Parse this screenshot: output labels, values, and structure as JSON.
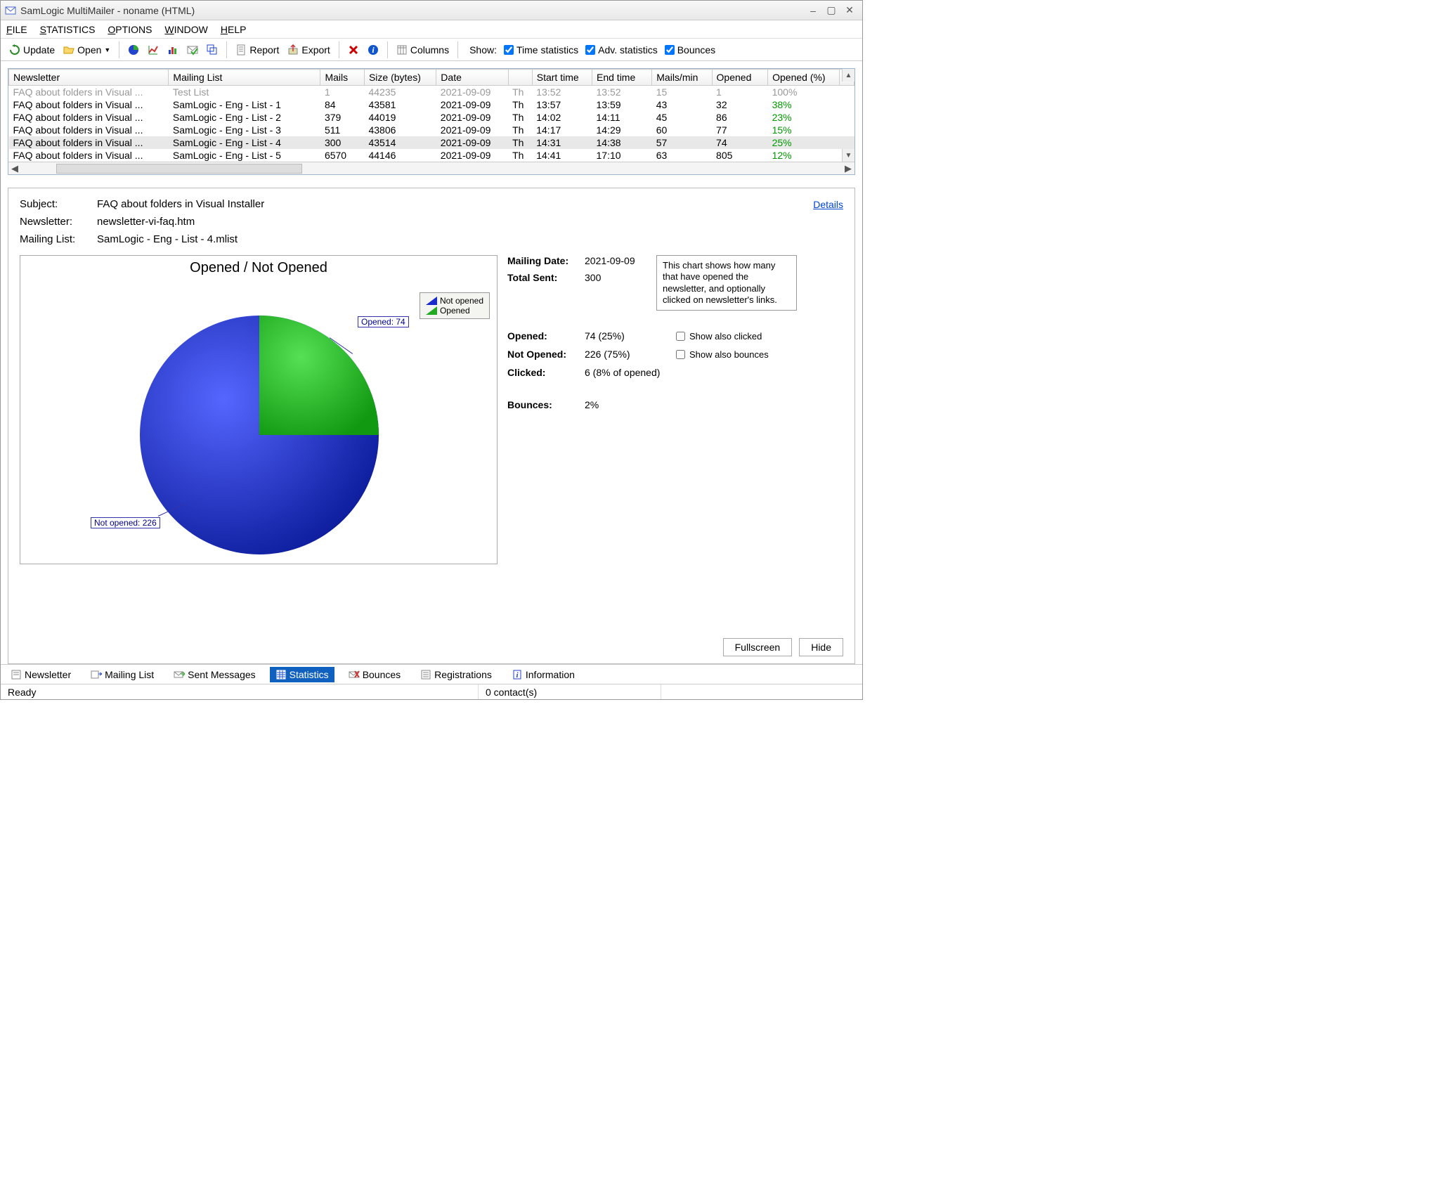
{
  "window": {
    "title": "SamLogic MultiMailer - noname  (HTML)"
  },
  "menubar": [
    "FILE",
    "STATISTICS",
    "OPTIONS",
    "WINDOW",
    "HELP"
  ],
  "toolbar": {
    "update": "Update",
    "open": "Open",
    "report": "Report",
    "export": "Export",
    "columns": "Columns",
    "show_label": "Show:",
    "chk_time": "Time statistics",
    "chk_adv": "Adv. statistics",
    "chk_bounces": "Bounces"
  },
  "table": {
    "headers": {
      "newsletter": "Newsletter",
      "list": "Mailing List",
      "mails": "Mails",
      "size": "Size (bytes)",
      "date": "Date",
      "day": "",
      "start": "Start time",
      "end": "End time",
      "rate": "Mails/min",
      "opened": "Opened",
      "pct": "Opened (%)"
    },
    "rows": [
      {
        "newsletter": "FAQ about folders in Visual ...",
        "list": "Test List",
        "mails": "1",
        "size": "44235",
        "date": "2021-09-09",
        "day": "Th",
        "start": "13:52",
        "end": "13:52",
        "rate": "15",
        "opened": "1",
        "pct": "100%",
        "faded": true,
        "pct_green": false
      },
      {
        "newsletter": "FAQ about folders in Visual ...",
        "list": "SamLogic - Eng - List - 1",
        "mails": "84",
        "size": "43581",
        "date": "2021-09-09",
        "day": "Th",
        "start": "13:57",
        "end": "13:59",
        "rate": "43",
        "opened": "32",
        "pct": "38%",
        "pct_green": true
      },
      {
        "newsletter": "FAQ about folders in Visual ...",
        "list": "SamLogic - Eng - List - 2",
        "mails": "379",
        "size": "44019",
        "date": "2021-09-09",
        "day": "Th",
        "start": "14:02",
        "end": "14:11",
        "rate": "45",
        "opened": "86",
        "pct": "23%",
        "pct_green": true
      },
      {
        "newsletter": "FAQ about folders in Visual ...",
        "list": "SamLogic - Eng - List - 3",
        "mails": "511",
        "size": "43806",
        "date": "2021-09-09",
        "day": "Th",
        "start": "14:17",
        "end": "14:29",
        "rate": "60",
        "opened": "77",
        "pct": "15%",
        "pct_green": true
      },
      {
        "newsletter": "FAQ about folders in Visual ...",
        "list": "SamLogic - Eng - List - 4",
        "mails": "300",
        "size": "43514",
        "date": "2021-09-09",
        "day": "Th",
        "start": "14:31",
        "end": "14:38",
        "rate": "57",
        "opened": "74",
        "pct": "25%",
        "pct_green": true,
        "selected": true
      },
      {
        "newsletter": "FAQ about folders in Visual ...",
        "list": "SamLogic - Eng - List - 5",
        "mails": "6570",
        "size": "44146",
        "date": "2021-09-09",
        "day": "Th",
        "start": "14:41",
        "end": "17:10",
        "rate": "63",
        "opened": "805",
        "pct": "12%",
        "pct_green": true
      }
    ]
  },
  "details": {
    "subject_label": "Subject:",
    "subject_value": "FAQ about folders in Visual Installer",
    "newsletter_label": "Newsletter:",
    "newsletter_value": "newsletter-vi-faq.htm",
    "list_label": "Mailing List:",
    "list_value": "SamLogic - Eng - List - 4.mlist",
    "details_link": "Details"
  },
  "chart": {
    "title": "Opened / Not Opened",
    "legend_notopened": "Not opened",
    "legend_opened": "Opened",
    "label_opened": "Opened: 74",
    "label_notopened": "Not opened: 226"
  },
  "chart_data": {
    "type": "pie",
    "title": "Opened / Not Opened",
    "series": [
      {
        "name": "Opened",
        "value": 74,
        "percent": 25,
        "color": "#33c233"
      },
      {
        "name": "Not opened",
        "value": 226,
        "percent": 75,
        "color": "#2233dd"
      }
    ],
    "total": 300
  },
  "side": {
    "mailing_date_label": "Mailing Date:",
    "mailing_date": "2021-09-09",
    "total_sent_label": "Total Sent:",
    "total_sent": "300",
    "info_text": "This chart shows how many that have opened the newsletter, and optionally clicked on newsletter's links.",
    "opened_label": "Opened:",
    "opened": "74  (25%)",
    "notopened_label": "Not Opened:",
    "notopened": "226  (75%)",
    "clicked_label": "Clicked:",
    "clicked": "6  (8% of opened)",
    "bounces_label": "Bounces:",
    "bounces": "2%",
    "chk_clicked": "Show also clicked",
    "chk_bounces": "Show also bounces",
    "fullscreen": "Fullscreen",
    "hide": "Hide"
  },
  "tabs": {
    "newsletter": "Newsletter",
    "mailinglist": "Mailing List",
    "sent": "Sent Messages",
    "statistics": "Statistics",
    "bounces": "Bounces",
    "registrations": "Registrations",
    "information": "Information"
  },
  "status": {
    "ready": "Ready",
    "contacts": "0 contact(s)"
  }
}
